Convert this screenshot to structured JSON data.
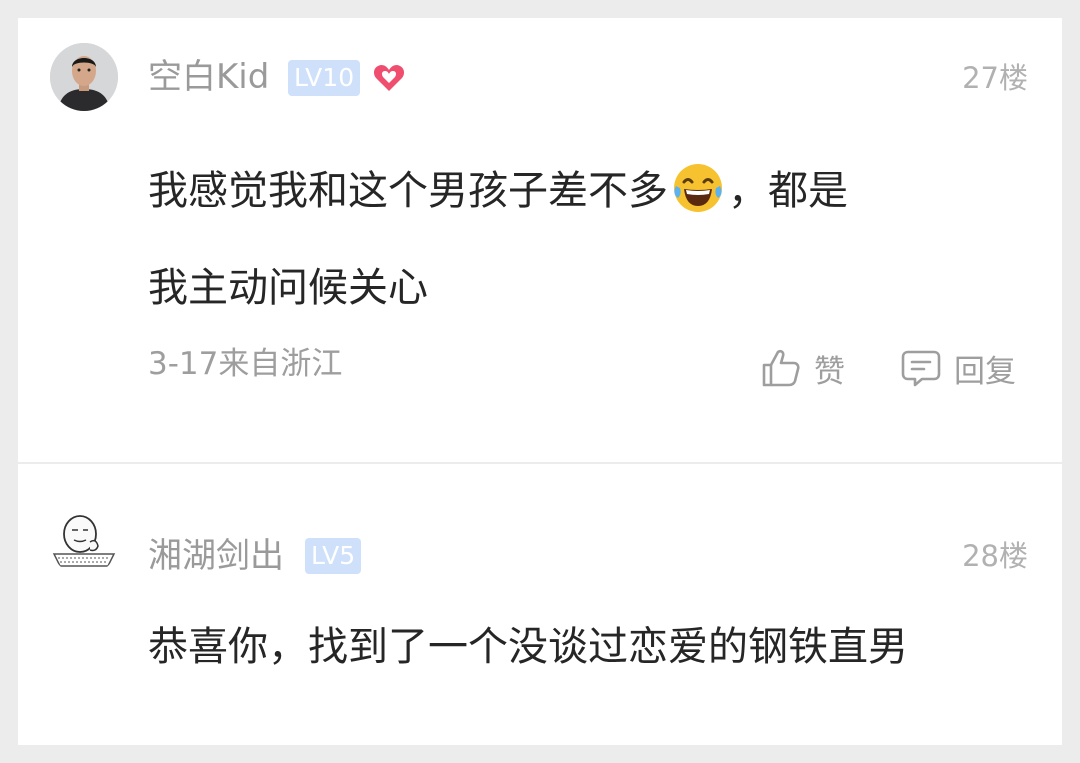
{
  "comments": [
    {
      "username": "空白Kid",
      "level": "LV10",
      "floor": "27楼",
      "text_line1_before_emoji": "我感觉我和这个男孩子差不多",
      "text_line1_after_emoji": "，都是",
      "text_line2": "我主动问候关心",
      "meta": "3-17来自浙江",
      "like_label": "赞",
      "reply_label": "回复",
      "icons": [
        "avatar",
        "heart-icon",
        "laughing-tears-emoji",
        "thumbs-up-icon",
        "comment-icon"
      ]
    },
    {
      "username": "湘湖剑出",
      "level": "LV5",
      "floor": "28楼",
      "text": "恭喜你，找到了一个没谈过恋爱的钢铁直男",
      "icons": [
        "avatar"
      ]
    }
  ],
  "colors": {
    "background": "#ececec",
    "card": "#ffffff",
    "username": "#9a9a9a",
    "level_badge": "#cfe0fb",
    "heart": "#f04e6e",
    "body_text": "#262626"
  }
}
